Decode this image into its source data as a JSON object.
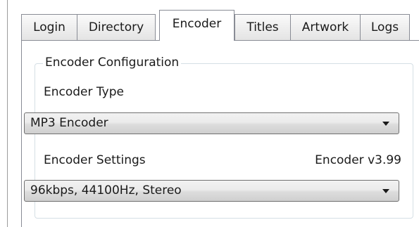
{
  "tabs": [
    {
      "label": "Login",
      "selected": false
    },
    {
      "label": "Directory",
      "selected": false
    },
    {
      "label": "Encoder",
      "selected": true
    },
    {
      "label": "Titles",
      "selected": false
    },
    {
      "label": "Artwork",
      "selected": false
    },
    {
      "label": "Logs",
      "selected": false
    }
  ],
  "group": {
    "title": "Encoder Configuration"
  },
  "encoder_type": {
    "label": "Encoder Type",
    "value": "MP3 Encoder",
    "arrow_icon": "chevron-down-icon"
  },
  "encoder_settings": {
    "label": "Encoder Settings",
    "version": "Encoder v3.99",
    "value": "96kbps, 44100Hz, Stereo",
    "arrow_icon": "chevron-down-icon"
  },
  "colors": {
    "border": "#898c95",
    "group_border": "#d5dfe5",
    "combo_border": "#707070",
    "text": "#1a1a1a"
  }
}
